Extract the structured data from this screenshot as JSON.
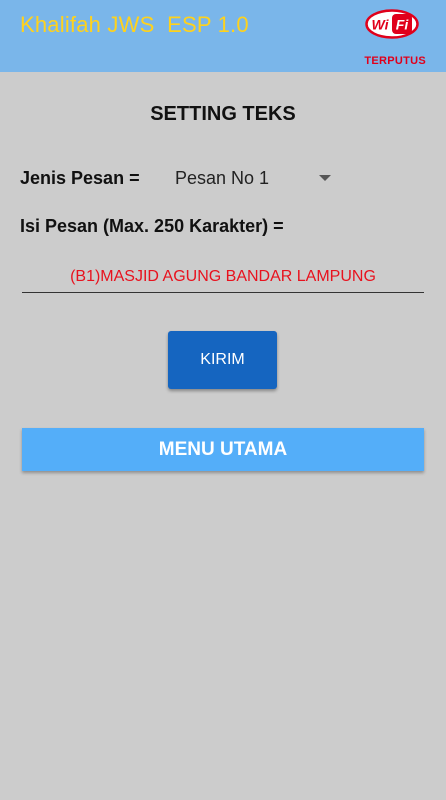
{
  "app": {
    "title": "Khalifah JWS  ESP 1.0",
    "wifi_logo_left": "Wi",
    "wifi_logo_right": "Fi",
    "wifi_status": "TERPUTUS"
  },
  "form": {
    "section_title": "SETTING TEKS",
    "jenis_label": "Jenis Pesan =",
    "jenis_selected": "Pesan No 1",
    "isi_label": "Isi Pesan (Max. 250 Karakter) =",
    "message_value": "(B1)MASJID AGUNG BANDAR LAMPUNG",
    "send_button": "KIRIM",
    "main_menu_button": "MENU UTAMA"
  },
  "colors": {
    "appbar": "#7ab6ea",
    "title_text": "#ffd21c",
    "wifi_red": "#e0001b",
    "background": "#cccccc",
    "send_button": "#1565c0",
    "menu_button": "#54aef9",
    "message_text": "#e8121e"
  },
  "icons": {
    "wifi_logo": "wifi-disconnected-icon",
    "dropdown": "caret-down-icon"
  }
}
